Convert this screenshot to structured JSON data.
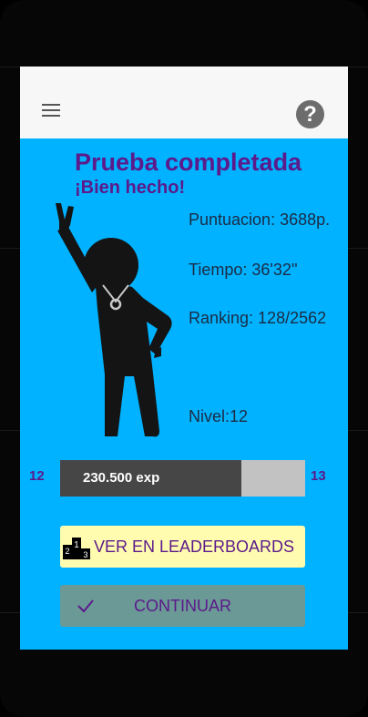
{
  "header": {
    "menu_icon": "hamburger-menu-icon",
    "help_icon": "question-mark-icon",
    "help_symbol": "?"
  },
  "result": {
    "title": "Prueba completada",
    "subtitle": "¡Bien hecho!",
    "score": "Puntuacion: 3688p.",
    "time": "Tiempo: 36'32''",
    "ranking": "Ranking: 128/2562",
    "level": "Nivel:12"
  },
  "progress": {
    "current_level": "12",
    "next_level": "13",
    "exp_label": "230.500 exp",
    "fraction": 0.74
  },
  "buttons": {
    "leaderboards": "VER EN LEADERBOARDS",
    "continue": "CONTINUAR"
  },
  "colors": {
    "screen_bg": "#00b2ff",
    "accent": "#5c1a8a",
    "leaderboard_btn": "#fffcb0",
    "continue_btn": "#6b9996"
  }
}
